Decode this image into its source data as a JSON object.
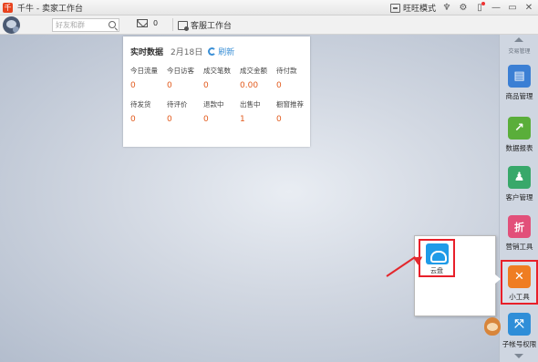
{
  "window": {
    "logo_char": "千",
    "title": "千牛 - 卖家工作台",
    "wangwang_mode": "旺旺模式"
  },
  "toolbar": {
    "search_placeholder": "好友和群",
    "mail_count": "0",
    "service_label": "客服工作台"
  },
  "realtime": {
    "title": "实时数据",
    "date": "2月18日",
    "refresh": "刷新",
    "metrics": [
      {
        "name": "今日流量",
        "value": "0"
      },
      {
        "name": "今日访客",
        "value": "0"
      },
      {
        "name": "成交笔数",
        "value": "0"
      },
      {
        "name": "成交金额",
        "value": "0.00"
      },
      {
        "name": "待付款",
        "value": "0"
      },
      {
        "name": "待发货",
        "value": "0"
      },
      {
        "name": "待评价",
        "value": "0"
      },
      {
        "name": "退款中",
        "value": "0"
      },
      {
        "name": "出售中",
        "value": "1"
      },
      {
        "name": "橱窗推荐",
        "value": "0"
      }
    ]
  },
  "sidebar": {
    "top_label": "交易管理",
    "items": [
      {
        "label": "商品管理",
        "icon": "product-icon",
        "glyph": "▤",
        "color": "#3b7fd4"
      },
      {
        "label": "数据报表",
        "icon": "chart-icon",
        "glyph": "↗",
        "color": "#5aae3a"
      },
      {
        "label": "客户管理",
        "icon": "customer-icon",
        "glyph": "♟",
        "color": "#38a86a"
      },
      {
        "label": "营销工具",
        "icon": "discount-icon",
        "glyph": "折",
        "color": "#e2507a"
      },
      {
        "label": "小工具",
        "icon": "tools-icon",
        "glyph": "✕",
        "color": "#ef7d22"
      },
      {
        "label": "子帐号权限",
        "icon": "subaccount-icon",
        "glyph": "⤧",
        "color": "#2f8ed8"
      }
    ]
  },
  "popup": {
    "cloud_label": "云盘"
  }
}
